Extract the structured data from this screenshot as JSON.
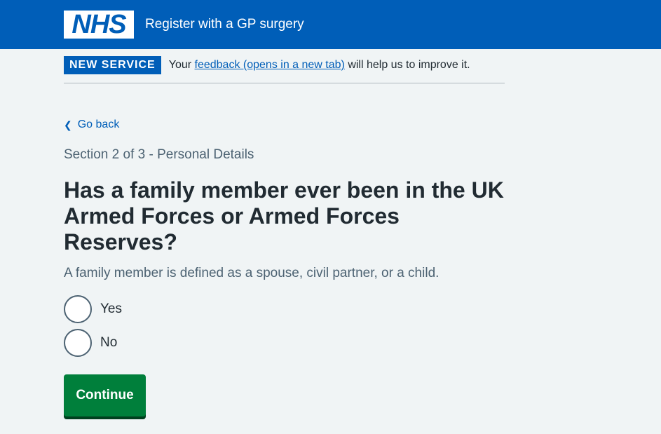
{
  "header": {
    "logo_text": "NHS",
    "service_name": "Register with a GP surgery"
  },
  "banner": {
    "tag": "NEW SERVICE",
    "text_before": "Your ",
    "link": "feedback (opens in a new tab)",
    "text_after": " will help us to improve it."
  },
  "nav": {
    "back_label": "Go back"
  },
  "question": {
    "caption": "Section 2 of 3 - Personal Details",
    "title": "Has a family member ever been in the UK Armed Forces or Armed Forces Reserves?",
    "hint": "A family member is defined as a spouse, civil partner, or a child.",
    "options": [
      "Yes",
      "No"
    ],
    "selected": null
  },
  "actions": {
    "continue_label": "Continue"
  },
  "colors": {
    "nhs_blue": "#005eb8",
    "button_green": "#007f3b",
    "background": "#f0f4f5"
  }
}
